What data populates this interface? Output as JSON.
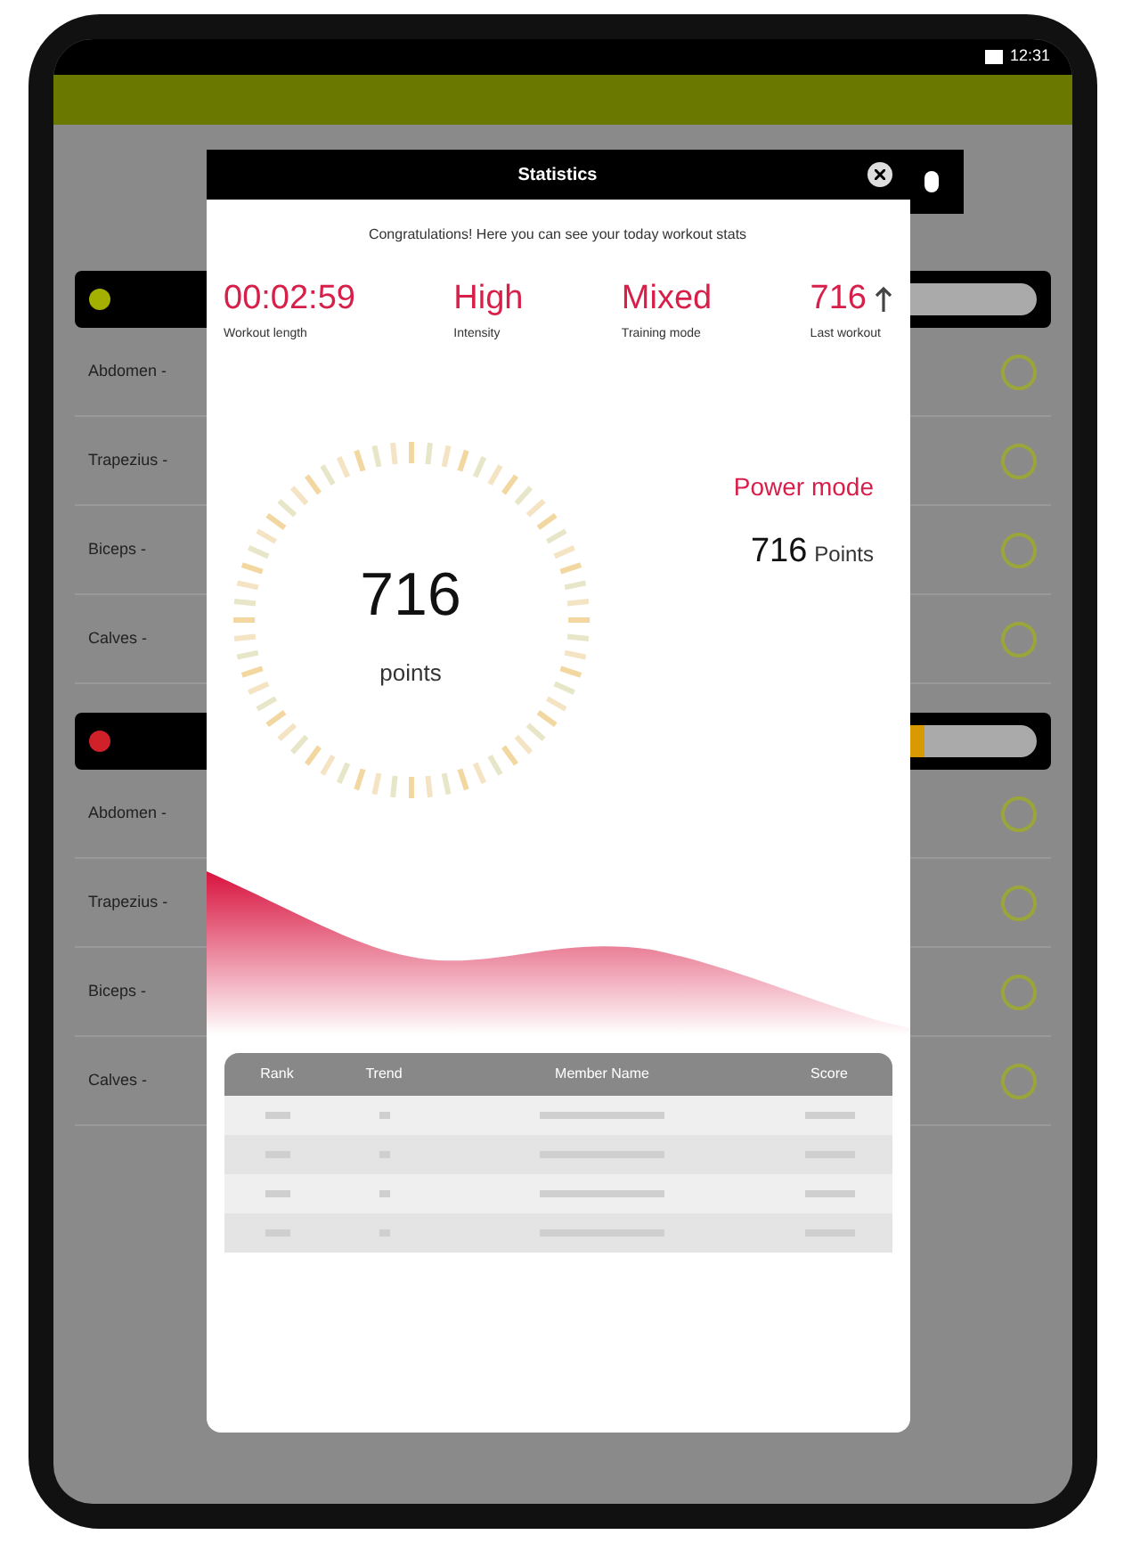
{
  "status_bar": {
    "time": "12:31"
  },
  "background_list": [
    {
      "color": "#a3b000",
      "rows": [
        "Abdomen -",
        "Trapezius -",
        "Biceps - ",
        "Calves - "
      ]
    },
    {
      "color": "#d0202a",
      "level": 0.3,
      "rows": [
        "Abdomen -",
        "Trapezius -",
        "Biceps - ",
        "Calves - "
      ]
    }
  ],
  "dialog": {
    "title": "Statistics",
    "subtitle": "Congratulations! Here you can see your today workout stats",
    "stats": [
      {
        "value": "00:02:59",
        "label": "Workout length",
        "trend_up": false
      },
      {
        "value": "High",
        "label": "Intensity",
        "trend_up": false
      },
      {
        "value": "Mixed",
        "label": "Training mode",
        "trend_up": false
      },
      {
        "value": "716",
        "label": "Last workout",
        "trend_up": true
      }
    ],
    "gauge": {
      "value": "716",
      "unit": "points"
    },
    "mode": {
      "title": "Power mode",
      "value": "716",
      "unit": "Points"
    },
    "table": {
      "columns": [
        "Rank",
        "Trend",
        "Member Name",
        "Score"
      ]
    }
  }
}
